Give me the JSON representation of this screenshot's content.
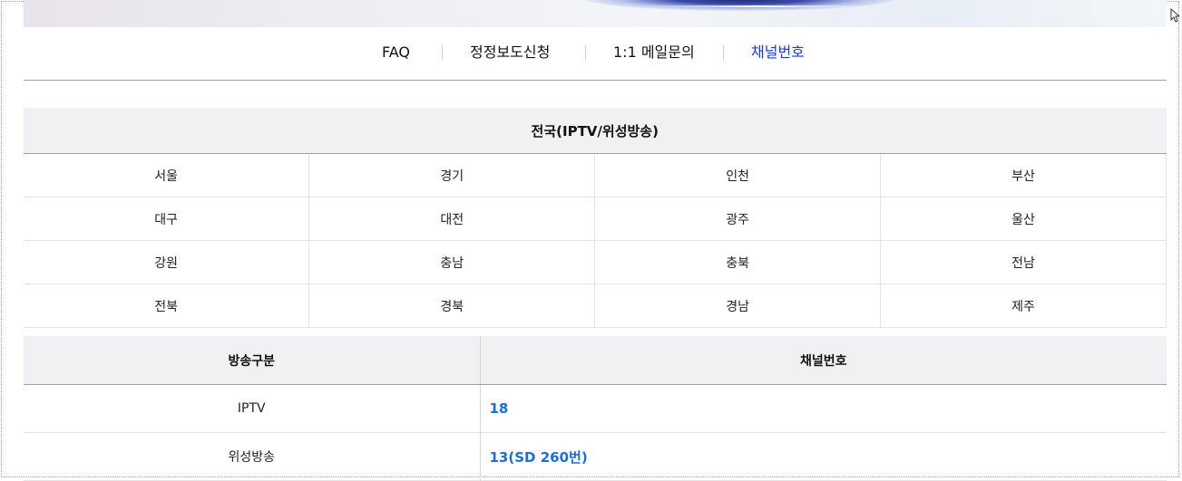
{
  "nav": {
    "items": [
      {
        "label": "FAQ",
        "active": false
      },
      {
        "label": "정정보도신청",
        "active": false
      },
      {
        "label": "1:1 메일문의",
        "active": false
      },
      {
        "label": "채널번호",
        "active": true
      }
    ]
  },
  "regions": {
    "header": "전국(IPTV/위성방송)",
    "rows": [
      [
        "서울",
        "경기",
        "인천",
        "부산"
      ],
      [
        "대구",
        "대전",
        "광주",
        "울산"
      ],
      [
        "강원",
        "충남",
        "충북",
        "전남"
      ],
      [
        "전북",
        "경북",
        "경남",
        "제주"
      ]
    ]
  },
  "channels": {
    "headers": {
      "kind": "방송구분",
      "number": "채널번호"
    },
    "rows": [
      {
        "kind": "IPTV",
        "number": "18"
      },
      {
        "kind": "위성방송",
        "number": "13(SD 260번)"
      }
    ]
  },
  "colors": {
    "active_nav": "#1a3ad6",
    "channel_number": "#1a6fd6",
    "header_bg": "#f1f1f3"
  }
}
